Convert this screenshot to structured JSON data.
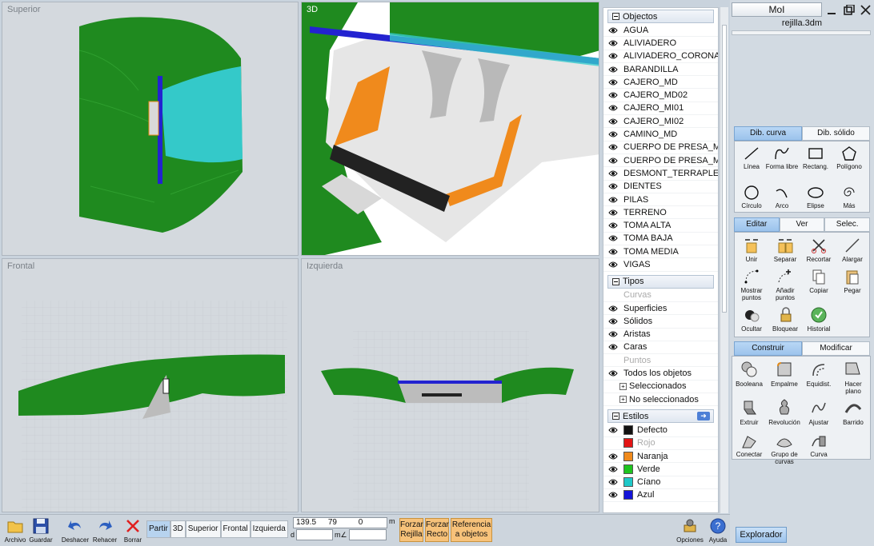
{
  "viewports": {
    "top_label": "Superior",
    "persp_label": "3D",
    "front_label": "Frontal",
    "left_label": "Izquierda"
  },
  "objects": {
    "header": "Objectos",
    "layers": [
      "AGUA",
      "ALIVIADERO",
      "ALIVIADERO_CORONA",
      "BARANDILLA",
      "CAJERO_MD",
      "CAJERO_MD02",
      "CAJERO_MI01",
      "CAJERO_MI02",
      "CAMINO_MD",
      "CUERPO DE PRESA_MD",
      "CUERPO DE PRESA_MI",
      "DESMONT_TERRAPLEN",
      "DIENTES",
      "PILAS",
      "TERRENO",
      "TOMA ALTA",
      "TOMA BAJA",
      "TOMA MEDIA",
      "VIGAS"
    ]
  },
  "types": {
    "header": "Tipos",
    "items": [
      {
        "label": "Curvas",
        "dim": true
      },
      {
        "label": "Superficies",
        "dim": false
      },
      {
        "label": "Sólidos",
        "dim": false
      },
      {
        "label": "Aristas",
        "dim": false
      },
      {
        "label": "Caras",
        "dim": false
      },
      {
        "label": "Puntos",
        "dim": true
      },
      {
        "label": "Todos los objetos",
        "dim": false
      }
    ],
    "selected": "Seleccionados",
    "unselected": "No seleccionados"
  },
  "styles": {
    "header": "Estilos",
    "items": [
      {
        "label": "Defecto",
        "color": "#111111",
        "dim": false
      },
      {
        "label": "Rojo",
        "color": "#e31414",
        "dim": true
      },
      {
        "label": "Naranja",
        "color": "#f08a1c",
        "dim": false
      },
      {
        "label": "Verde",
        "color": "#1ec41e",
        "dim": false
      },
      {
        "label": "Cíano",
        "color": "#1ec8c8",
        "dim": false
      },
      {
        "label": "Azul",
        "color": "#1414d8",
        "dim": false
      }
    ]
  },
  "app": {
    "name": "MoI",
    "filename": "rejilla.3dm"
  },
  "draw_tabs": {
    "curve": "Dib. curva",
    "solid": "Dib. sólido"
  },
  "draw_tools": [
    "Línea",
    "Forma libre",
    "Rectang.",
    "Polígono",
    "Círculo",
    "Arco",
    "Elipse",
    "Más"
  ],
  "edit_tabs": {
    "edit": "Editar",
    "view": "Ver",
    "select": "Selec."
  },
  "edit_tools": [
    "Unir",
    "Separar",
    "Recortar",
    "Alargar",
    "Mostrar puntos",
    "Añadir puntos",
    "Copiar",
    "Pegar",
    "Ocultar",
    "Bloquear",
    "Historial"
  ],
  "build_tabs": {
    "build": "Construir",
    "modify": "Modificar"
  },
  "build_tools": [
    "Booleana",
    "Empalme",
    "Equidist.",
    "Hacer plano",
    "Extruir",
    "Revolución",
    "Ajustar",
    "Barrido",
    "Conectar",
    "Grupo de curvas",
    "Curva"
  ],
  "bottom": {
    "file": "Archivo",
    "save": "Guardar",
    "undo": "Deshacer",
    "redo": "Rehacer",
    "delete": "Borrar",
    "views": [
      "Partir",
      "3D",
      "Superior",
      "Frontal",
      "Izquierda"
    ],
    "coord_x": "139.5",
    "coord_y": "79",
    "coord_z": "0",
    "unit": "m",
    "d_label": "d",
    "angle_label": "m∠",
    "grid_snap": "Forzar Rejilla",
    "straight_snap": "Forzar Recto",
    "object_ref": "Referencia a objetos",
    "options": "Opciones",
    "help": "Ayuda",
    "explorer": "Explorador"
  },
  "colors": {
    "terrain": "#1f8a1f",
    "water": "#34c9c9",
    "dam_blue": "#2323d0",
    "orange": "#f08a1c"
  }
}
